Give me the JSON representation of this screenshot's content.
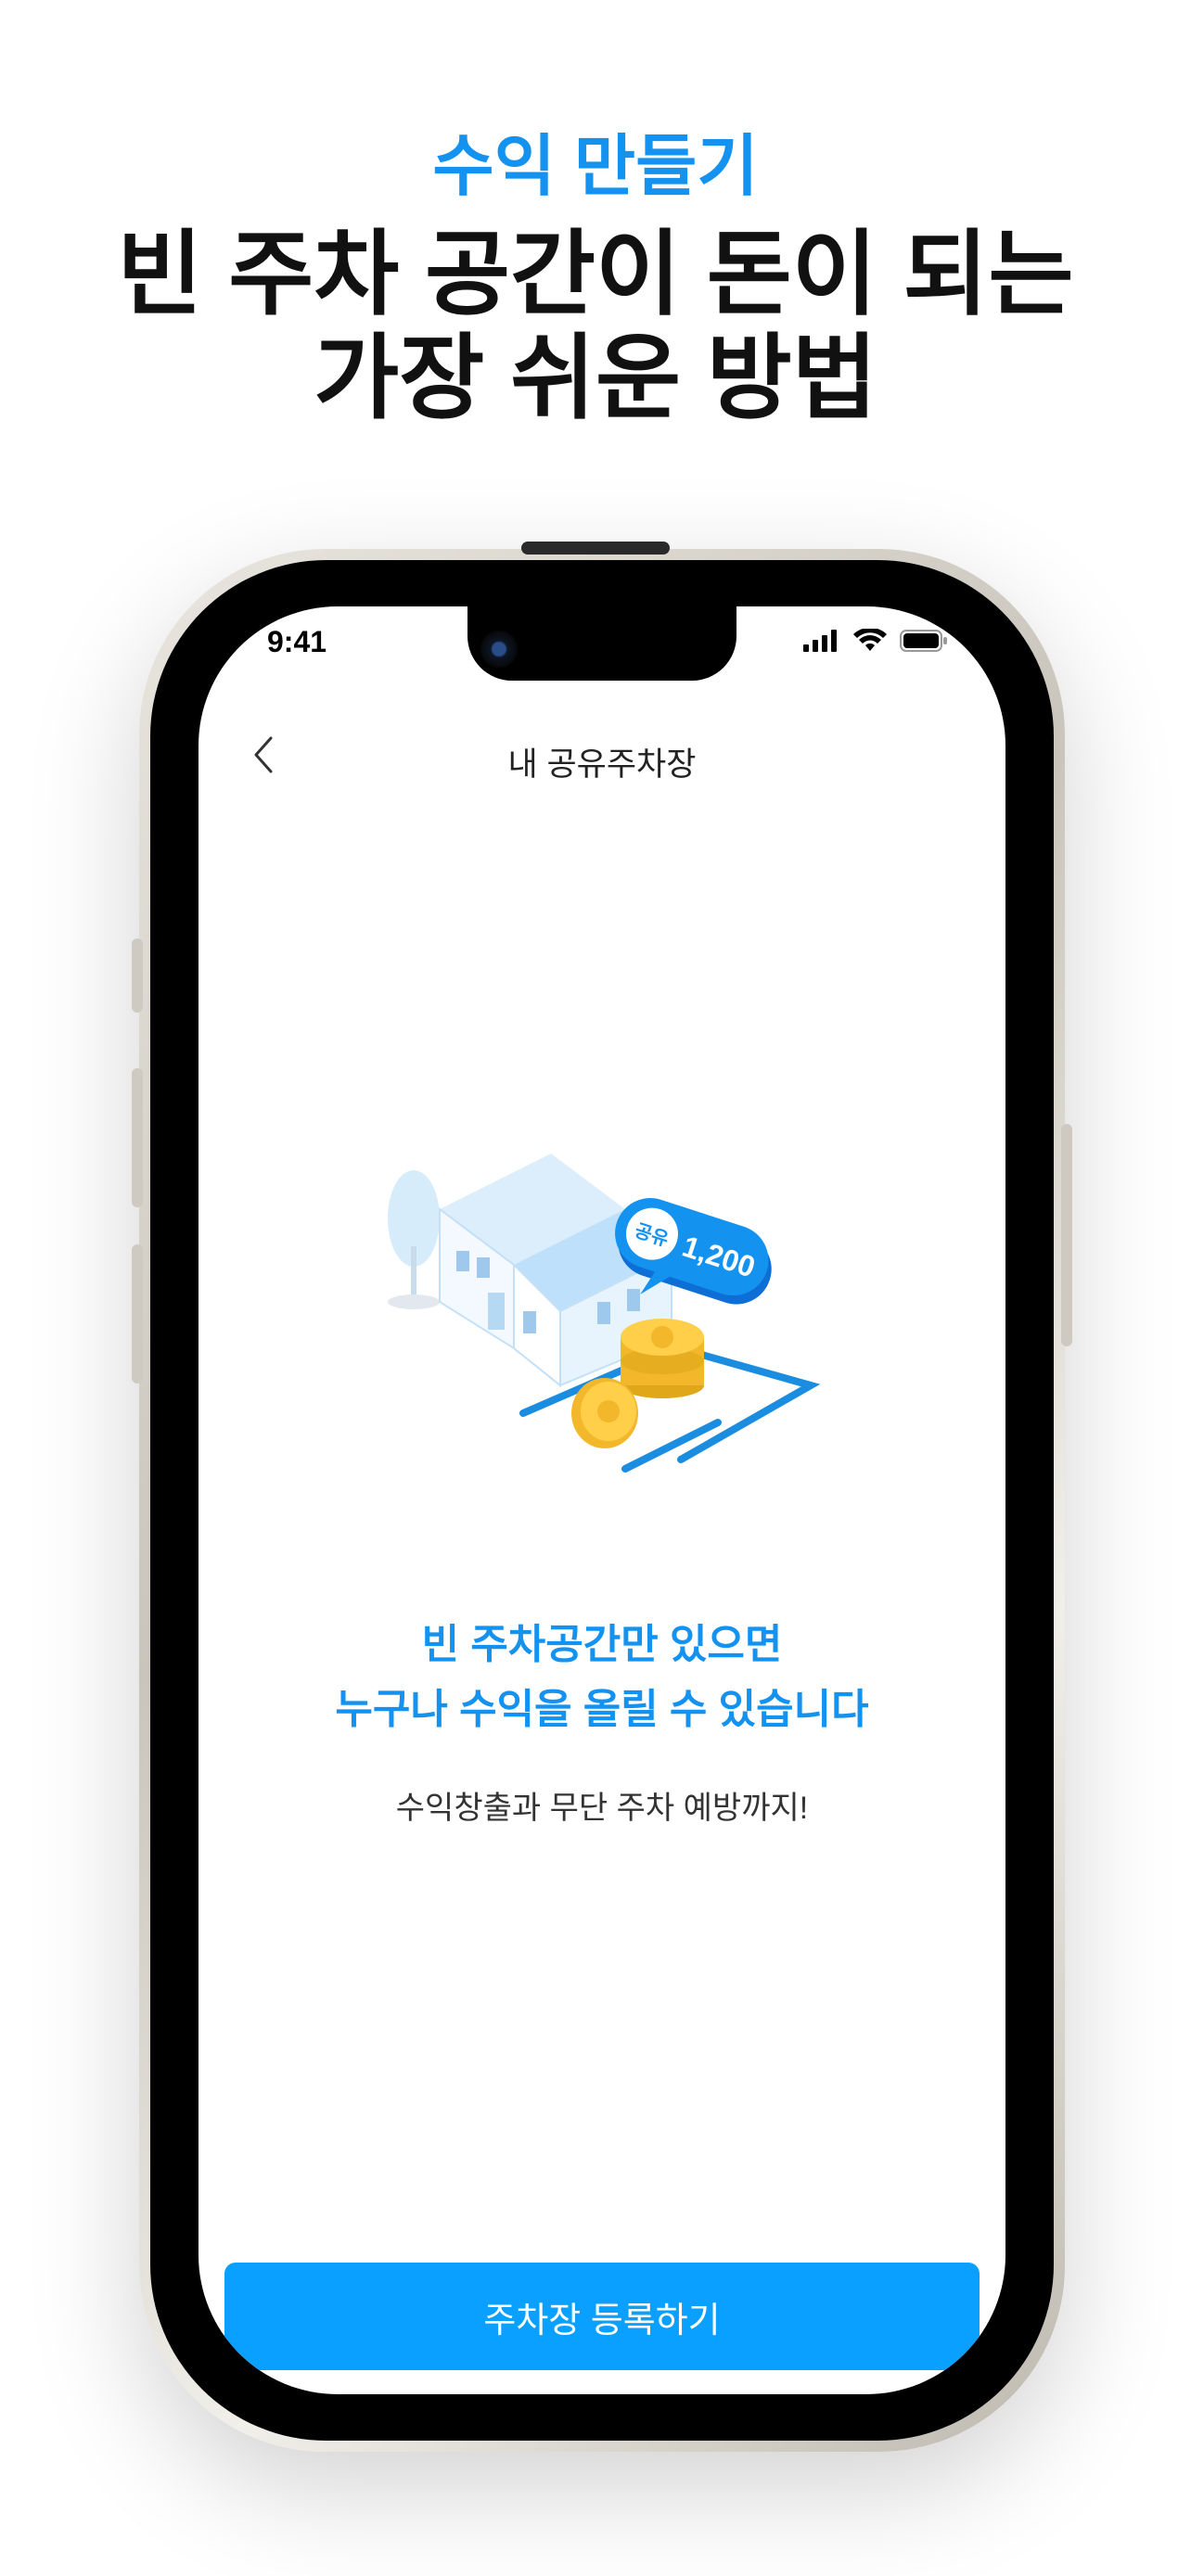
{
  "promo": {
    "subtitle": "수익 만들기",
    "title_line1": "빈 주차 공간이 돈이 되는",
    "title_line2": "가장 쉬운 방법"
  },
  "status_bar": {
    "time": "9:41",
    "icons": [
      "signal-icon",
      "wifi-icon",
      "battery-icon"
    ]
  },
  "nav": {
    "back_icon": "chevron-left-icon",
    "title": "내 공유주차장"
  },
  "illustration": {
    "badge_label": "공유",
    "badge_value": "1,200"
  },
  "content": {
    "headline_line1": "빈 주차공간만 있으면",
    "headline_line2": "누구나 수익을 올릴 수 있습니다",
    "description": "수익창출과 무단 주차 예방까지!"
  },
  "cta": {
    "label": "주차장 등록하기"
  },
  "colors": {
    "accent": "#1492f0",
    "button": "#0aa0ff"
  }
}
